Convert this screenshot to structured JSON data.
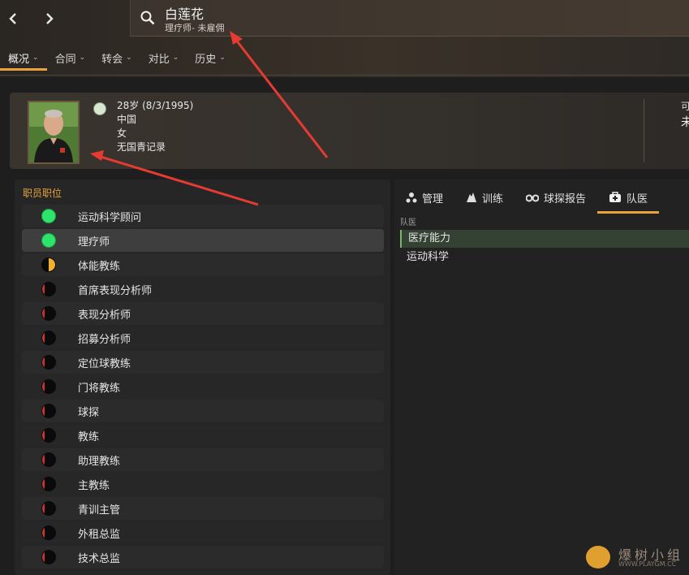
{
  "search": {
    "name": "白莲花",
    "subtitle": "理疗师- 未雇佣"
  },
  "menu": [
    {
      "label": "概况"
    },
    {
      "label": "合同"
    },
    {
      "label": "转会"
    },
    {
      "label": "对比"
    },
    {
      "label": "历史"
    }
  ],
  "profile": {
    "age_birth": "28岁 (8/3/1995)",
    "nation": "中国",
    "gender": "女",
    "youth": "无国青记录",
    "right_top": "可",
    "right_bottom": "未"
  },
  "roles_section": {
    "title": "职员职位"
  },
  "roles": [
    {
      "label": "运动科学顾问",
      "rating": "green"
    },
    {
      "label": "理疗师",
      "rating": "green"
    },
    {
      "label": "体能教练",
      "rating": "half"
    },
    {
      "label": "首席表现分析师",
      "rating": "red"
    },
    {
      "label": "表现分析师",
      "rating": "red"
    },
    {
      "label": "招募分析师",
      "rating": "red"
    },
    {
      "label": "定位球教练",
      "rating": "red"
    },
    {
      "label": "门将教练",
      "rating": "red"
    },
    {
      "label": "球探",
      "rating": "red"
    },
    {
      "label": "教练",
      "rating": "red"
    },
    {
      "label": "助理教练",
      "rating": "red"
    },
    {
      "label": "主教练",
      "rating": "red"
    },
    {
      "label": "青训主管",
      "rating": "red"
    },
    {
      "label": "外租总监",
      "rating": "red"
    },
    {
      "label": "技术总监",
      "rating": "red"
    }
  ],
  "tabs": [
    {
      "label": "管理",
      "icon": "management-icon"
    },
    {
      "label": "训练",
      "icon": "training-icon"
    },
    {
      "label": "球探报告",
      "icon": "binoculars-icon"
    },
    {
      "label": "队医",
      "icon": "medical-kit-icon"
    }
  ],
  "medical": {
    "subhead": "队医",
    "attributes": [
      "医疗能力",
      "运动科学"
    ]
  },
  "watermark": {
    "text": "爆树小组",
    "url": "WWW.PLAYGM.CC"
  }
}
